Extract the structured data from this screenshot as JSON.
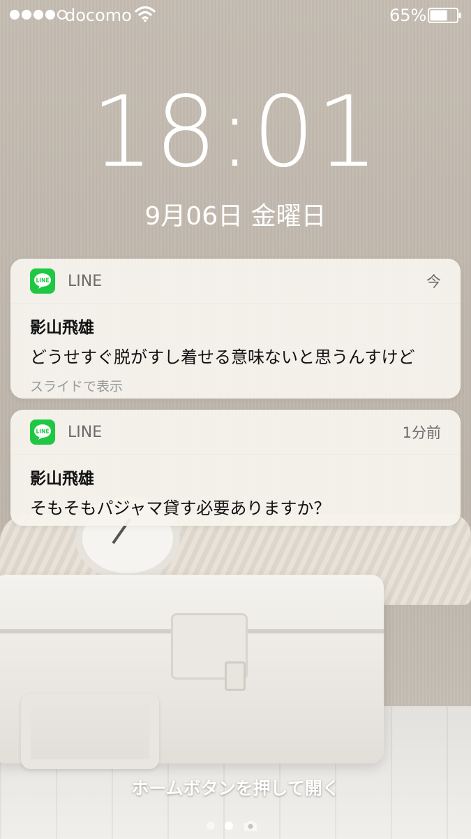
{
  "status_bar": {
    "signal_filled": 4,
    "signal_total": 5,
    "carrier": "docomo",
    "battery_percent_label": "65%",
    "battery_level": 0.65
  },
  "lock": {
    "time": "18:01",
    "date": "9月06日 金曜日"
  },
  "notifications": [
    {
      "app": "LINE",
      "time": "今",
      "sender": "影山飛雄",
      "message": "どうせすぐ脱がすし着せる意味ないと思うんすけど",
      "hint": "スライドで表示"
    },
    {
      "app": "LINE",
      "time": "1分前",
      "sender": "影山飛雄",
      "message": "そもそもパジャマ貸す必要ありますか？"
    }
  ],
  "footer": {
    "home_hint": "ホームボタンを押して開く",
    "page_count": 2,
    "active_page": 2,
    "camera_icon": "camera-icon"
  },
  "colors": {
    "line_green": "#1fc743"
  }
}
